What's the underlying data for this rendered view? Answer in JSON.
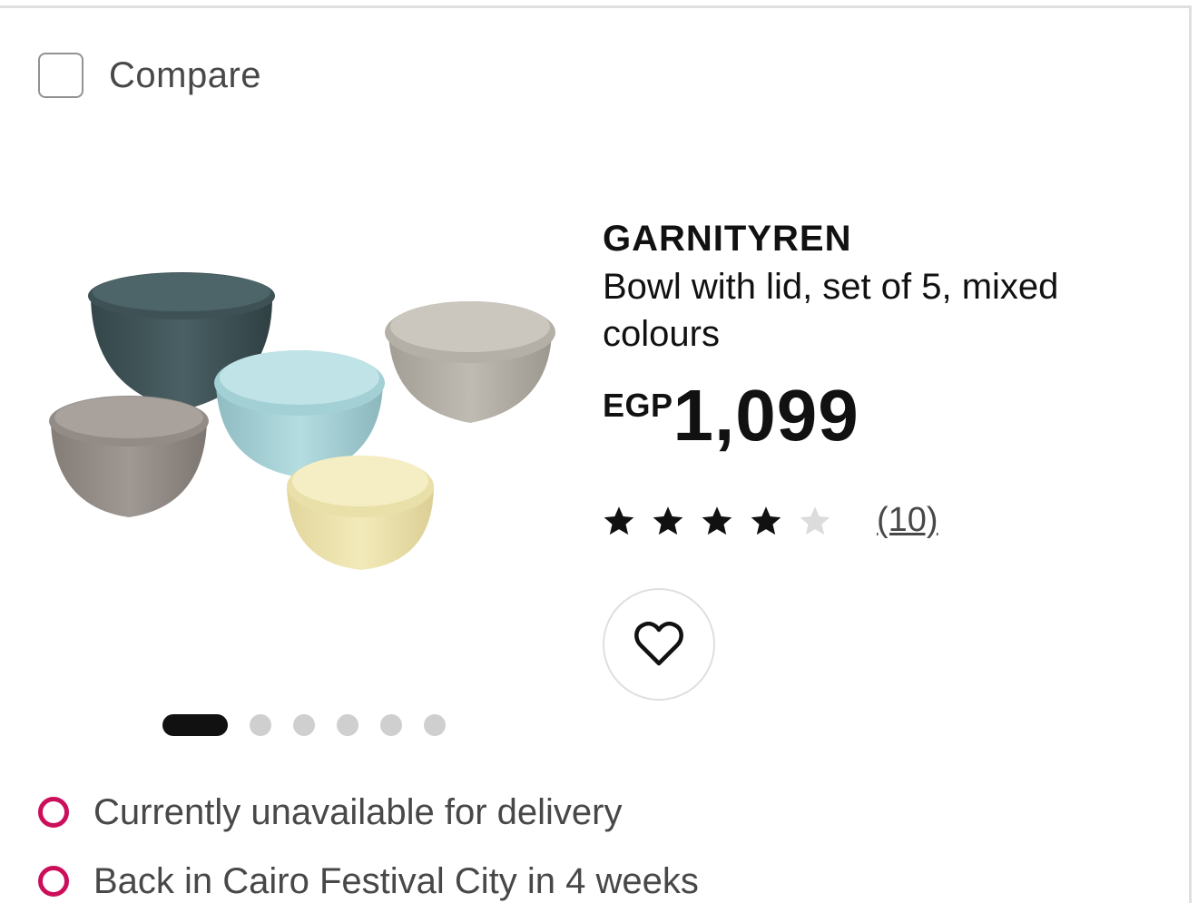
{
  "compare": {
    "label": "Compare",
    "checked": false
  },
  "product": {
    "name": "GARNITYREN",
    "description": "Bowl with lid, set of 5, mixed colours",
    "price": {
      "currency": "EGP",
      "amount": "1,099"
    },
    "rating": {
      "stars": 4.5,
      "max": 5,
      "count_label": "(10)"
    },
    "image": {
      "icon": "bowl-set-image",
      "bowl_colors": [
        "#3f5559",
        "#a6d2d6",
        "#b5b1a8",
        "#948d87",
        "#ece3b0"
      ]
    }
  },
  "carousel": {
    "total": 6,
    "active_index": 0
  },
  "favourite": {
    "icon": "heart-icon"
  },
  "availability": [
    {
      "text": "Currently unavailable for delivery",
      "status_color": "#cc0f5a"
    },
    {
      "text": "Back in Cairo Festival City in 4 weeks",
      "status_color": "#cc0f5a"
    }
  ]
}
